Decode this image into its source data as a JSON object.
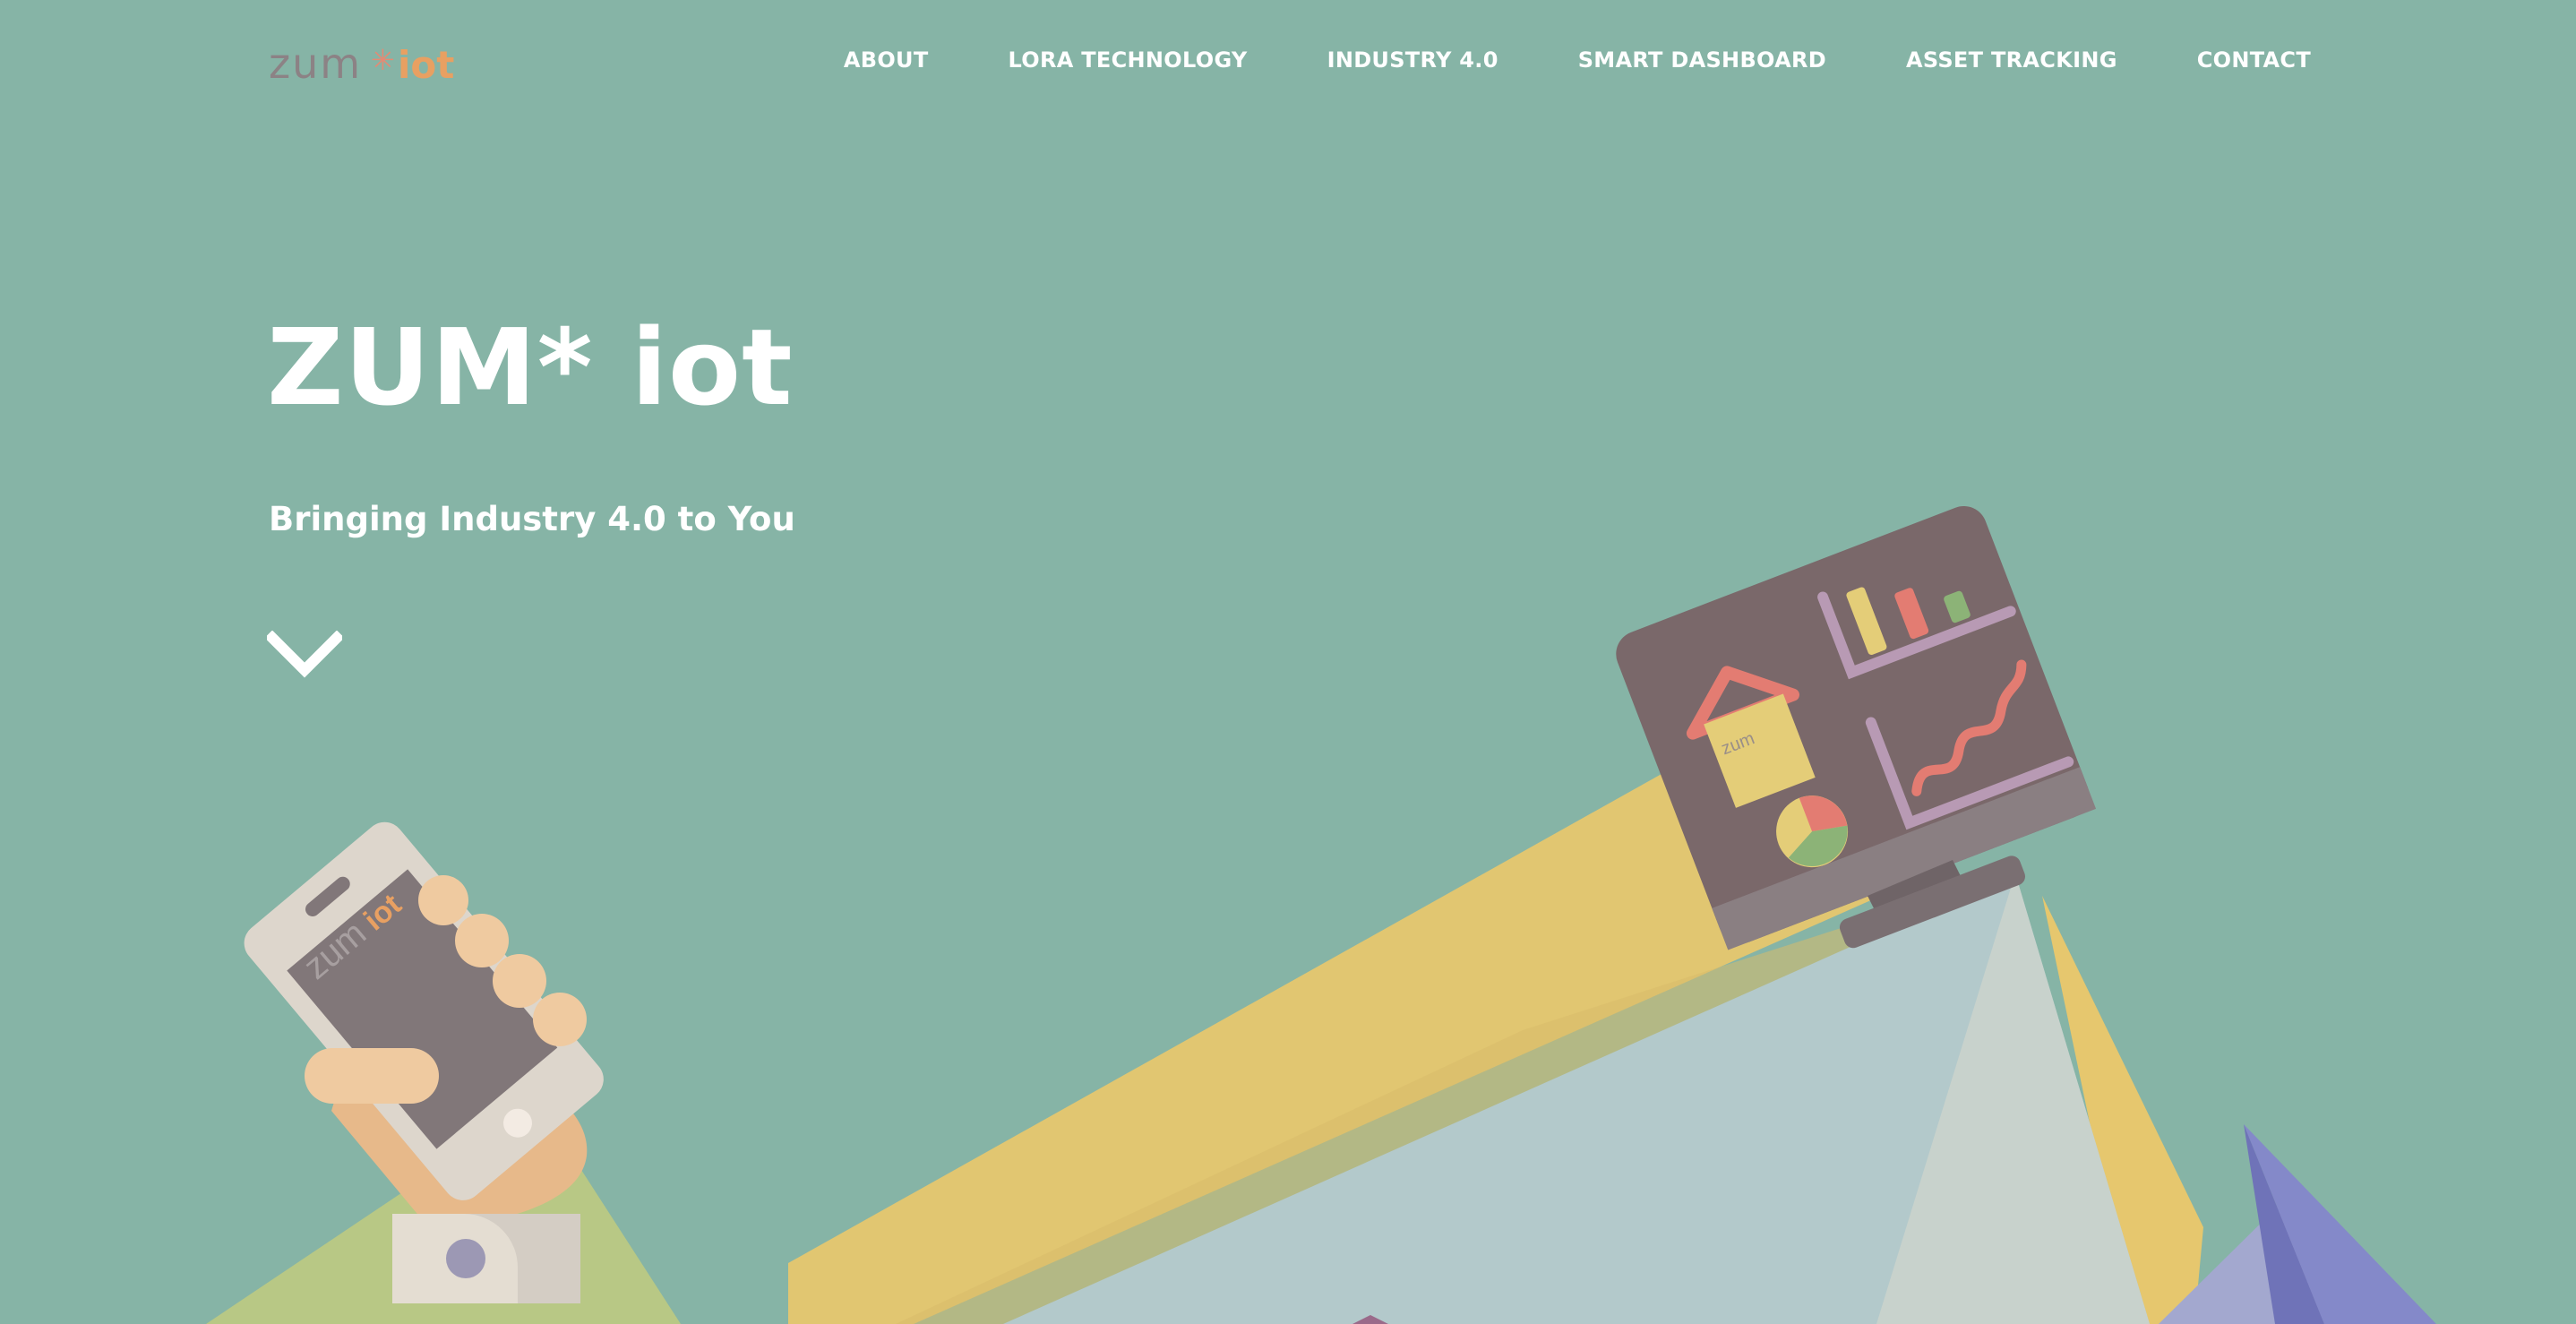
{
  "brand": {
    "logo_word": "zum",
    "logo_star": "✳",
    "logo_suffix": "iot"
  },
  "nav": {
    "items": [
      {
        "label": "ABOUT"
      },
      {
        "label": "LORA TECHNOLOGY"
      },
      {
        "label": "INDUSTRY 4.0"
      },
      {
        "label": "SMART DASHBOARD"
      },
      {
        "label": "ASSET TRACKING"
      },
      {
        "label": "CONTACT"
      }
    ]
  },
  "hero": {
    "title": "ZUM* iot",
    "subtitle": "Bringing Industry 4.0 to You",
    "scroll_icon": "chevron-down-icon"
  },
  "illustration": {
    "phone_logo_word": "zum",
    "phone_logo_suffix": "iot",
    "dashboard_house_label": "zum"
  },
  "colors": {
    "background": "#86b4a6",
    "text": "#ffffff",
    "logo_grey": "#8c8285",
    "logo_orange": "#e8a062",
    "beam_yellow": "#e6c76e",
    "mountain_blue": "#b3c9cb",
    "monitor": "#7a686a"
  }
}
